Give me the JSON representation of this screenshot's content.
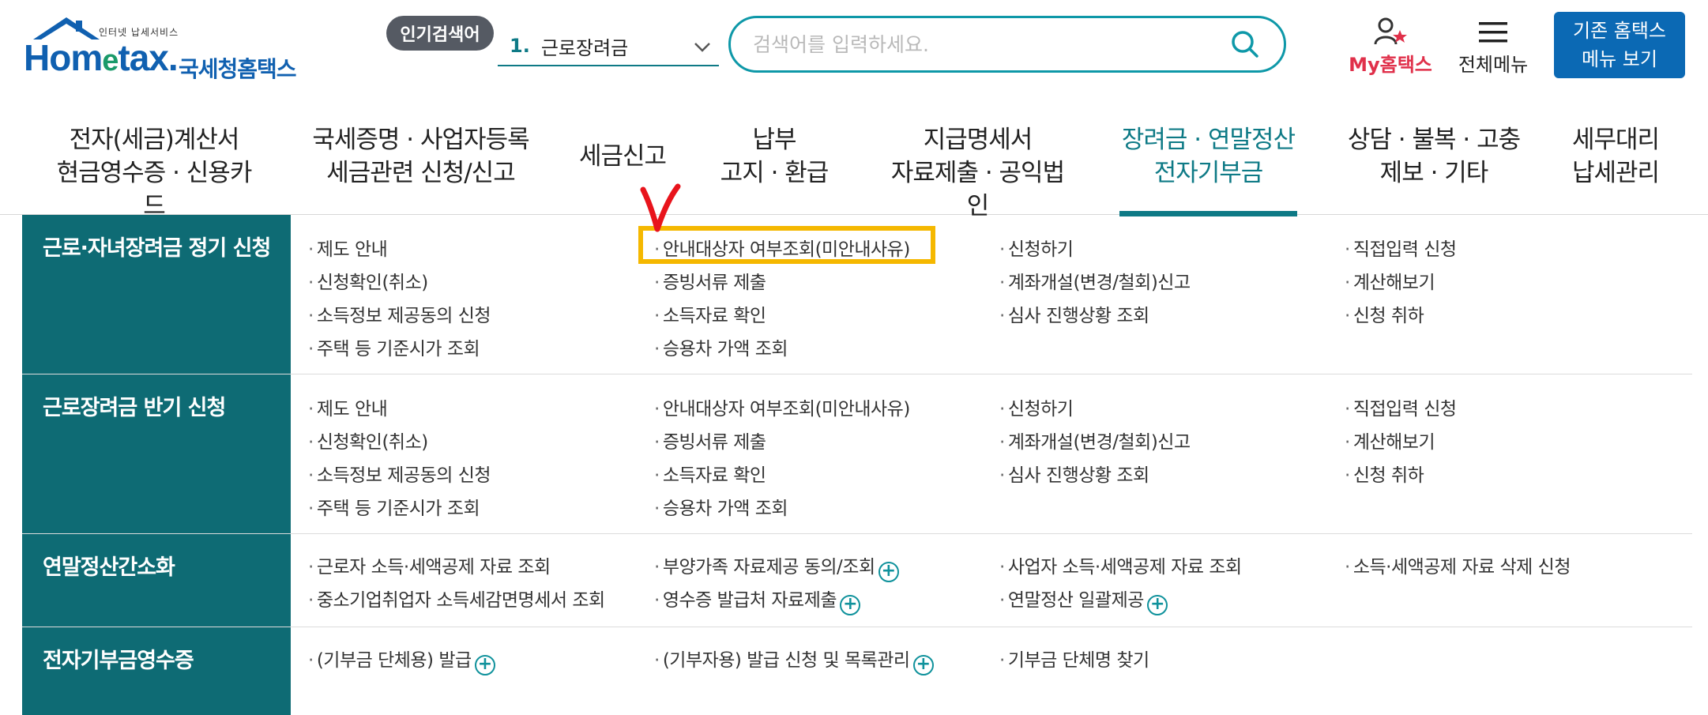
{
  "header": {
    "logo": {
      "tagline": "인터넷 납세서비스",
      "brand_en_pre": "Hom",
      "brand_en_e": "e",
      "brand_en_post": "tax.",
      "brand_kr": "국세청홈택스",
      "house_icon": "house-icon"
    },
    "popular": {
      "badge": "인기검색어",
      "rank": "1.",
      "term": "근로장려금",
      "chevron_icon": "chevron-down-icon"
    },
    "search": {
      "placeholder": "검색어를 입력하세요.",
      "value": "",
      "icon": "search-icon"
    },
    "my_hometax": {
      "label": "My홈택스",
      "icon": "user-star-icon"
    },
    "all_menu": {
      "label": "전체메뉴",
      "icon": "hamburger-icon"
    },
    "old_view": {
      "line1": "기존 홈택스",
      "line2": "메뉴 보기"
    }
  },
  "nav": {
    "items": [
      {
        "line1": "전자(세금)계산서",
        "line2": "현금영수증 · 신용카드"
      },
      {
        "line1": "국세증명 · 사업자등록",
        "line2": "세금관련 신청/신고"
      },
      {
        "line1": "세금신고",
        "line2": ""
      },
      {
        "line1": "납부",
        "line2": "고지 · 환급"
      },
      {
        "line1": "지급명세서",
        "line2": "자료제출 · 공익법인"
      },
      {
        "line1": "장려금 · 연말정산",
        "line2": "전자기부금"
      },
      {
        "line1": "상담 · 불복 · 고충",
        "line2": "제보 · 기타"
      },
      {
        "line1": "세무대리",
        "line2": "납세관리"
      }
    ],
    "active_index": 5
  },
  "menu": {
    "rows": [
      {
        "category": "근로·자녀장려금 정기 신청",
        "col1": [
          "제도 안내",
          "신청확인(취소)",
          "소득정보 제공동의 신청",
          "주택 등 기준시가 조회"
        ],
        "col2": [
          "안내대상자 여부조회(미안내사유)",
          "증빙서류 제출",
          "소득자료 확인",
          "승용차 가액 조회"
        ],
        "col3": [
          "신청하기",
          "계좌개설(변경/철회)신고",
          "심사 진행상황 조회"
        ],
        "col4": [
          "직접입력 신청",
          "계산해보기",
          "신청 취하"
        ]
      },
      {
        "category": "근로장려금 반기 신청",
        "col1": [
          "제도 안내",
          "신청확인(취소)",
          "소득정보 제공동의 신청",
          "주택 등 기준시가 조회"
        ],
        "col2": [
          "안내대상자 여부조회(미안내사유)",
          "증빙서류 제출",
          "소득자료 확인",
          "승용차 가액 조회"
        ],
        "col3": [
          "신청하기",
          "계좌개설(변경/철회)신고",
          "심사 진행상황 조회"
        ],
        "col4": [
          "직접입력 신청",
          "계산해보기",
          "신청 취하"
        ]
      },
      {
        "category": "연말정산간소화",
        "col1": [
          "근로자 소득·세액공제 자료 조회",
          "중소기업취업자 소득세감면명세서 조회"
        ],
        "col2": [
          "부양가족 자료제공 동의/조회",
          "영수증 발급처 자료제출"
        ],
        "col3": [
          "사업자 소득·세액공제 자료 조회",
          "연말정산 일괄제공"
        ],
        "col4": [
          "소득·세액공제 자료 삭제 신청"
        ]
      },
      {
        "category": "전자기부금영수증",
        "col1": [
          "(기부금 단체용) 발급"
        ],
        "col2": [
          "(기부자용) 발급 신청 및 목록관리"
        ],
        "col3": [
          "기부금 단체명 찾기"
        ],
        "col4": []
      }
    ],
    "plus_icon": "plus-circle-icon",
    "plus_symbol": "+",
    "highlight_color": "#f5b800",
    "check_mark_color": "#e8141c"
  },
  "colors": {
    "brand_teal": "#0e6b74",
    "active_teal": "#0e7a86",
    "button_blue": "#0b69b4",
    "my_red": "#e0304a"
  }
}
